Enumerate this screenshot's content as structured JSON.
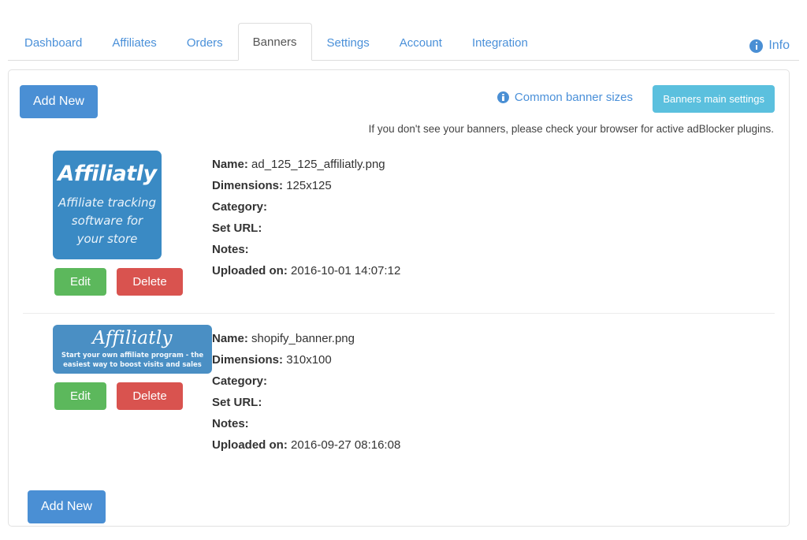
{
  "nav": {
    "tabs": [
      {
        "label": "Dashboard",
        "active": false
      },
      {
        "label": "Affiliates",
        "active": false
      },
      {
        "label": "Orders",
        "active": false
      },
      {
        "label": "Banners",
        "active": true
      },
      {
        "label": "Settings",
        "active": false
      },
      {
        "label": "Account",
        "active": false
      },
      {
        "label": "Integration",
        "active": false
      }
    ],
    "info_label": "Info",
    "info_icon": "info-circle-icon"
  },
  "toolbar": {
    "add_new_label": "Add New",
    "common_sizes_label": "Common banner sizes",
    "common_sizes_icon": "info-circle-icon",
    "main_settings_label": "Banners main settings",
    "adblock_note": "If you don't see your banners, please check your browser for active adBlocker plugins."
  },
  "labels": {
    "name": "Name:",
    "dimensions": "Dimensions:",
    "category": "Category:",
    "set_url": "Set URL:",
    "notes": "Notes:",
    "uploaded_on": "Uploaded on:",
    "edit": "Edit",
    "delete": "Delete"
  },
  "banners": [
    {
      "name": "ad_125_125_affiliatly.png",
      "dimensions": "125x125",
      "category": "",
      "set_url": "",
      "notes": "",
      "uploaded_on": "2016-10-01 14:07:12",
      "art": {
        "logo": "Affiliatly",
        "line1": "Affiliate tracking",
        "line2": "software for",
        "line3": "your store"
      }
    },
    {
      "name": "shopify_banner.png",
      "dimensions": "310x100",
      "category": "",
      "set_url": "",
      "notes": "",
      "uploaded_on": "2016-09-27 08:16:08",
      "art": {
        "logo": "Affiliatly",
        "line1": "Start your own affiliate program - the",
        "line2": "easiest way to boost visits and sales"
      }
    }
  ],
  "footer": {
    "add_new_label": "Add New"
  },
  "colors": {
    "primary_blue": "#4a8fd4",
    "link_blue": "#4a90d9",
    "info_blue": "#5bc0de",
    "success_green": "#5cb85c",
    "danger_red": "#d9534f",
    "banner_blue": "#3a8ac4"
  }
}
